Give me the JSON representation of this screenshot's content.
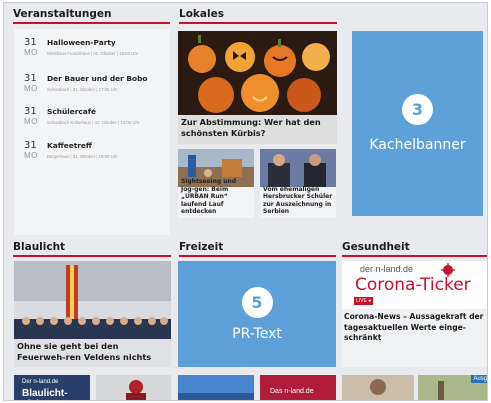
{
  "sections": {
    "veranstaltungen": "Veranstaltungen",
    "lokales": "Lokales",
    "blaulicht": "Blaulicht",
    "freizeit": "Freizeit",
    "gesundheit": "Gesundheit"
  },
  "events": [
    {
      "day": "31",
      "month": "MO",
      "title": "Halloween-Party",
      "meta": "Wirtshaus Froschhaus | 31. Oktober | 18:00 Uhr"
    },
    {
      "day": "31",
      "month": "MO",
      "title": "Der Bauer und der Bobo",
      "meta": "Schwabach | 31. Oktober | 17:00 Uhr"
    },
    {
      "day": "31",
      "month": "MO",
      "title": "Schülercafé",
      "meta": "Schwabach Kulturhaus | 31. Oktober | 14:00 Uhr"
    },
    {
      "day": "31",
      "month": "MO",
      "title": "Kaffeetreff",
      "meta": "Bürgerhaus | 31. Oktober | 15:00 Uhr"
    }
  ],
  "lokales": {
    "main_caption": "Zur Abstimmung: Wer hat den schönsten Kürbis?",
    "small1": "Sightseeing und Jog-gen: Beim „URBAN Run“ laufend Lauf entdecken",
    "small2": "Vom ehemaligen Hersbrucker Schüler zur Auszeichnung in Serbien"
  },
  "kachel": {
    "number": "3",
    "label": "Kachelbanner"
  },
  "blaulicht": {
    "caption": "Ohne sie geht bei den Feuerweh-ren Veldens nichts"
  },
  "freizeit": {
    "number": "5",
    "label": "PR-Text"
  },
  "gesundheit": {
    "logo_text": "der n-land.de",
    "ticker_text": "Corona-Ticker",
    "live": "LIVE ●",
    "caption": "Corona-News – Aussagekraft der tagesaktuellen Werte einge-schränkt"
  },
  "bottom": {
    "thumb1_line1": "Der n-land.de",
    "thumb1_line2": "Blaulicht-Ticker",
    "thumb4": "Das n-land.de",
    "badge": "Ausg"
  },
  "colors": {
    "accent": "#c8102e",
    "tile_blue": "#5da1d8",
    "frame_bg": "#e9eaee"
  }
}
